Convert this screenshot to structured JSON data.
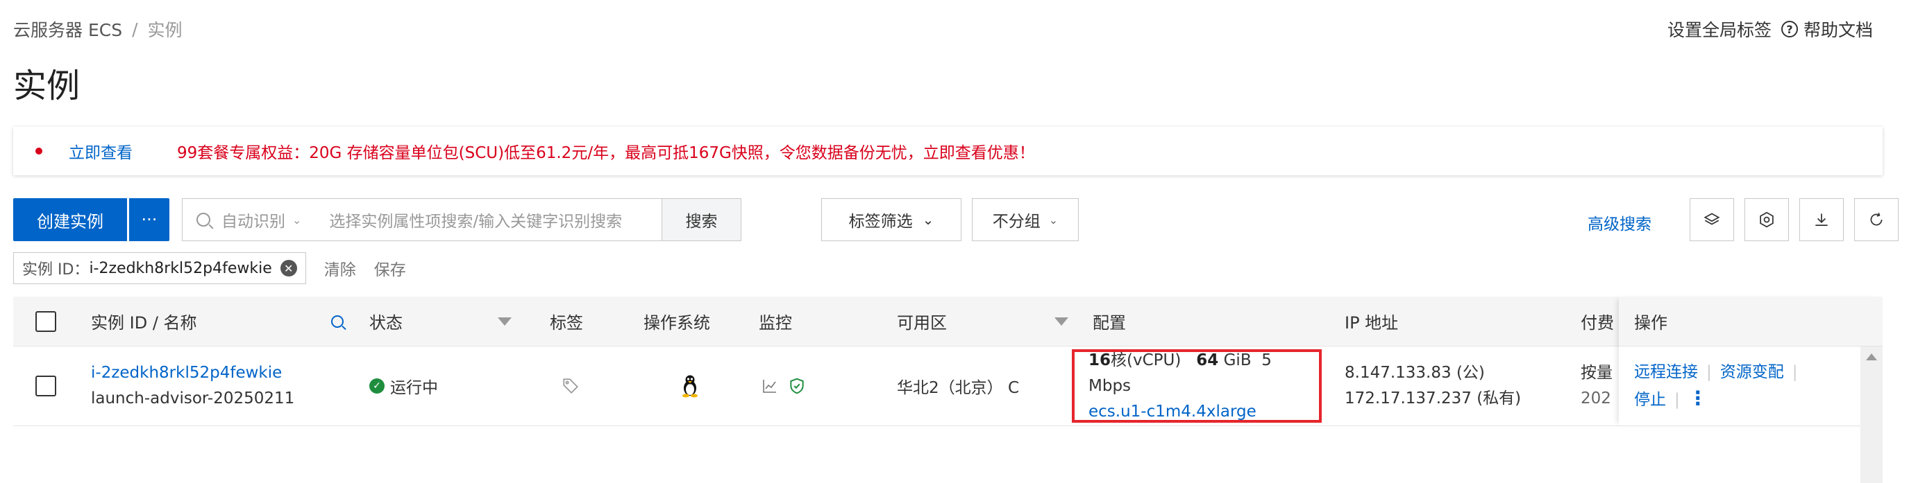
{
  "breadcrumb": {
    "root": "云服务器 ECS",
    "separator": "/",
    "current": "实例"
  },
  "top_links": {
    "global_tags": "设置全局标签",
    "help_icon": "?",
    "help": "帮助文档"
  },
  "page_title": "实例",
  "notice": {
    "link": "立即查看",
    "promo": "99套餐专属权益：20G 存储容量单位包(SCU)低至61.2元/年，最高可抵167G快照，令您数据备份无忧，立即查看优惠！"
  },
  "toolbar": {
    "create_label": "创建实例",
    "more_label": "···",
    "search_mode": "自动识别",
    "search_placeholder": "选择实例属性项搜索/输入关键字识别搜索",
    "search_button": "搜索",
    "tag_filter": "标签筛选",
    "group": "不分组",
    "advanced_search": "高级搜索",
    "icons": [
      "layers-icon",
      "settings-icon",
      "download-icon",
      "refresh-icon"
    ]
  },
  "filter": {
    "key": "实例 ID：",
    "value": "i-2zedkh8rkl52p4fewkie",
    "clear": "清除",
    "save": "保存"
  },
  "table": {
    "columns": {
      "id_name": "实例 ID / 名称",
      "status": "状态",
      "tags": "标签",
      "os": "操作系统",
      "monitor": "监控",
      "zone": "可用区",
      "config": "配置",
      "ip": "IP 地址",
      "billing": "付费",
      "ops": "操作"
    },
    "rows": [
      {
        "id": "i-2zedkh8rkl52p4fewkie",
        "name": "launch-advisor-20250211",
        "status": "运行中",
        "zone": "华北2（北京） C",
        "config_cpu_num": "16",
        "config_cpu_unit": "核(vCPU)",
        "config_mem_num": "64",
        "config_mem_unit": "GiB",
        "config_bw": "5 Mbps",
        "config_type": "ecs.u1-c1m4.4xlarge",
        "ip_public": "8.147.133.83 (公)",
        "ip_private": "172.17.137.237 (私有)",
        "billing_1": "按量",
        "billing_2": "202",
        "op_remote": "远程连接",
        "op_change": "资源变配",
        "op_stop": "停止",
        "op_more": "⋮"
      }
    ]
  },
  "colors": {
    "primary": "#0064c8",
    "danger": "#d9001b",
    "success": "#1e8e3e",
    "highlight_box": "#e5262c"
  }
}
